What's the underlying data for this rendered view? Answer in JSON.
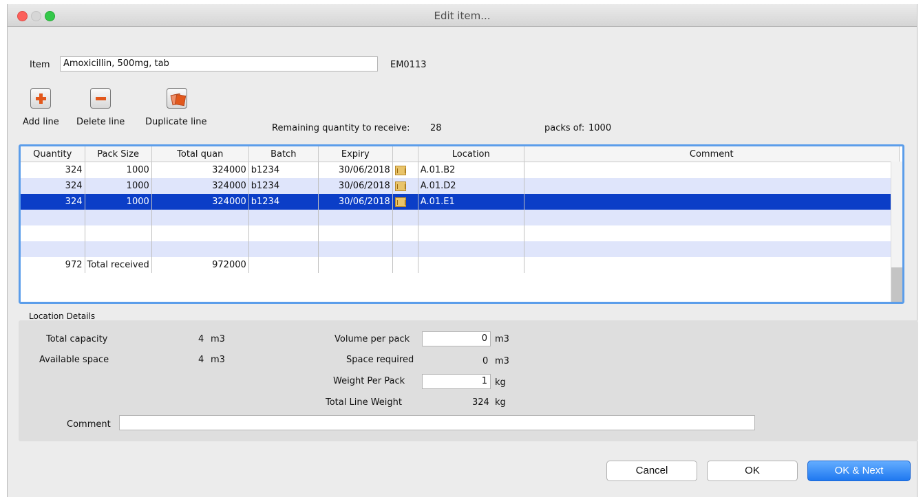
{
  "window": {
    "title": "Edit item..."
  },
  "item": {
    "label": "Item",
    "value": "Amoxicillin, 500mg, tab",
    "code": "EM0113"
  },
  "toolbar": {
    "add_line": "Add line",
    "delete_line": "Delete line",
    "duplicate_line": "Duplicate line"
  },
  "remaining": {
    "label": "Remaining quantity to receive:",
    "value": "28",
    "packs_label": "packs of:",
    "packs_value": "1000"
  },
  "grid": {
    "columns": [
      "Quantity",
      "Pack Size",
      "Total quan",
      "Batch",
      "Expiry",
      "",
      "Location",
      "Comment"
    ],
    "rows": [
      {
        "quantity": "324",
        "pack_size": "1000",
        "total": "324000",
        "batch": "b1234",
        "expiry": "30/06/2018",
        "location": "A.01.B2",
        "comment": ""
      },
      {
        "quantity": "324",
        "pack_size": "1000",
        "total": "324000",
        "batch": "b1234",
        "expiry": "30/06/2018",
        "location": "A.01.D2",
        "comment": ""
      },
      {
        "quantity": "324",
        "pack_size": "1000",
        "total": "324000",
        "batch": "b1234",
        "expiry": "30/06/2018",
        "location": "A.01.E1",
        "comment": ""
      }
    ],
    "selected_row": 2,
    "totals": {
      "quantity": "972",
      "label": "Total received",
      "total": "972000"
    }
  },
  "location_details": {
    "heading": "Location Details",
    "total_capacity_label": "Total capacity",
    "total_capacity_value": "4",
    "total_capacity_unit": "m3",
    "available_space_label": "Available space",
    "available_space_value": "4",
    "available_space_unit": "m3",
    "volume_per_pack_label": "Volume per pack",
    "volume_per_pack_value": "0",
    "volume_per_pack_unit": "m3",
    "space_required_label": "Space required",
    "space_required_value": "0",
    "space_required_unit": "m3",
    "weight_per_pack_label": "Weight Per Pack",
    "weight_per_pack_value": "1",
    "weight_per_pack_unit": "kg",
    "total_line_weight_label": "Total Line Weight",
    "total_line_weight_value": "324",
    "total_line_weight_unit": "kg",
    "comment_label": "Comment",
    "comment_value": ""
  },
  "buttons": {
    "cancel": "Cancel",
    "ok": "OK",
    "ok_next": "OK & Next"
  },
  "colors": {
    "selection": "#0b3ec7",
    "alt_row": "#dfe5fb",
    "focus_ring": "#5b9dea",
    "primary_button": "#1f78f0"
  }
}
